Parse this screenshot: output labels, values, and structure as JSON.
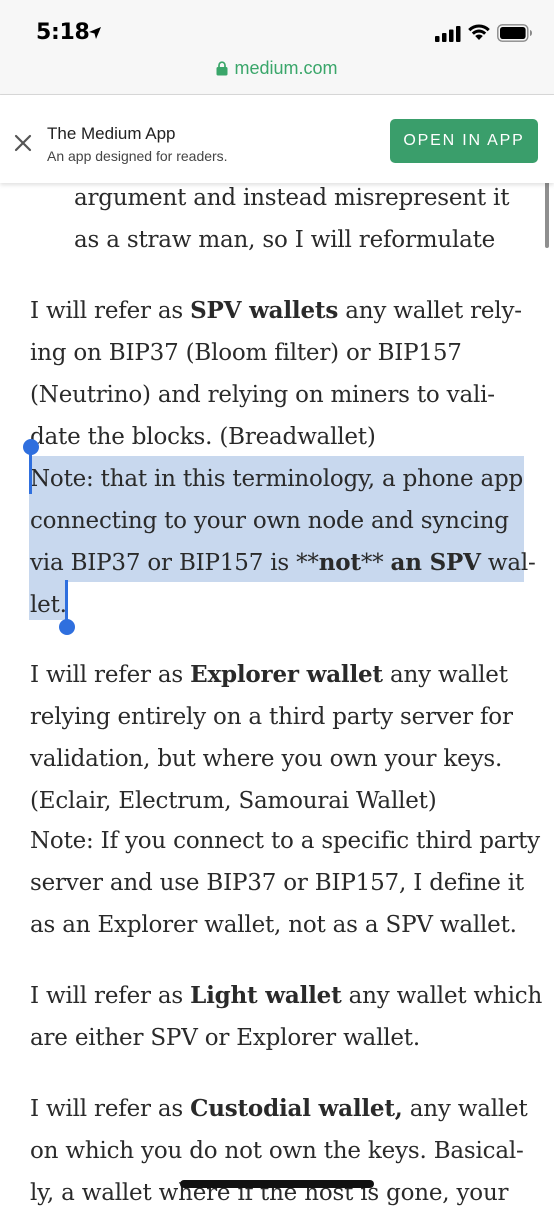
{
  "status_bar": {
    "time": "5:18"
  },
  "browser": {
    "domain": "medium.com"
  },
  "banner": {
    "title": "The Medium App",
    "subtitle": "An app designed for readers.",
    "open_label": "OPEN IN APP"
  },
  "article": {
    "quote_lines": [
      "argument and instead misrepresent it",
      "as a straw man, so I will reformulate"
    ],
    "p1": {
      "l1_a": "I will refer as ",
      "l1_b": "SPV wallets",
      "l1_c": " any wallet rely-",
      "l2": "ing on BIP37 (Bloom filter) or BIP157",
      "l3": "(Neutrino) and relying on miners to vali-",
      "l4": "date the blocks. (Breadwallet)",
      "l5": "Note: that in this terminology, a phone app",
      "l6": "connecting to your own node and syncing",
      "l7_a": "via BIP37 or BIP157 is **",
      "l7_b": "not",
      "l7_c": "** ",
      "l7_d": "an SPV",
      "l7_e": " wal-",
      "l8": "let."
    },
    "p2": {
      "l1_a": "I will refer as ",
      "l1_b": "Explorer wallet",
      "l1_c": " any wallet",
      "l2": "relying entirely on a third party server for",
      "l3": "validation, but where you own your keys.",
      "l4": "(Eclair, Electrum, Samourai Wallet)",
      "l5": "Note: If you connect to a specific third party",
      "l6": "server and use BIP37 or BIP157, I define it",
      "l7": "as an Explorer wallet, not as a SPV wallet."
    },
    "p3": {
      "l1_a": "I will refer as ",
      "l1_b": "Light wallet",
      "l1_c": " any wallet which",
      "l2": "are either SPV or Explorer wallet."
    },
    "p4": {
      "l1_a": "I will refer as ",
      "l1_b": "Custodial wallet,",
      "l1_c": " any wallet",
      "l2": "on which you do not own the keys. Basical-",
      "l3": "ly, a wallet where if the host is gone, your"
    }
  },
  "colors": {
    "accent_green": "#3a9e6b",
    "selection": "#c8d8ee",
    "caret": "#2f6fde"
  }
}
